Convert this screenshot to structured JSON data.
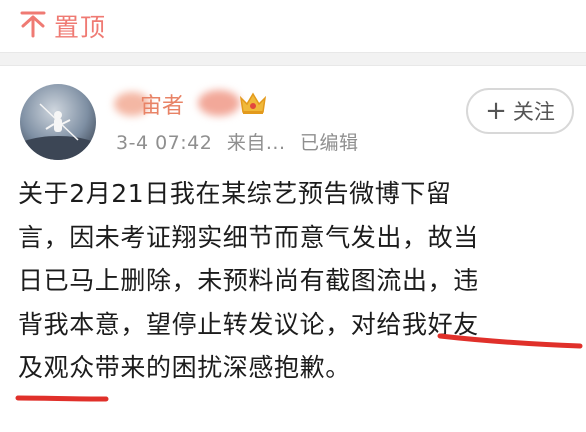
{
  "pinned": {
    "label": "置顶"
  },
  "user": {
    "name_visible": "宙者",
    "badge_icon": "crown-icon",
    "timestamp": "3-4 07:42",
    "source": "来自...",
    "edited": "已编辑"
  },
  "follow_button": {
    "label": "关注",
    "plus": "+"
  },
  "post": {
    "lines": [
      "关于2月21日我在某综艺预告微博下留",
      "言，因未考证翔实细节而意气发出，故当",
      "日已马上删除，未预料尚有截图流出，违",
      "背我本意，望停止转发议论，对给我好友",
      "及观众带来的困扰深感抱歉。"
    ]
  },
  "colors": {
    "accent_pin": "#ef7a73",
    "username": "#e88366",
    "meta_text": "#8f8f8f",
    "annotation_red": "#e0302a",
    "crown_gold": "#f0b93a"
  }
}
